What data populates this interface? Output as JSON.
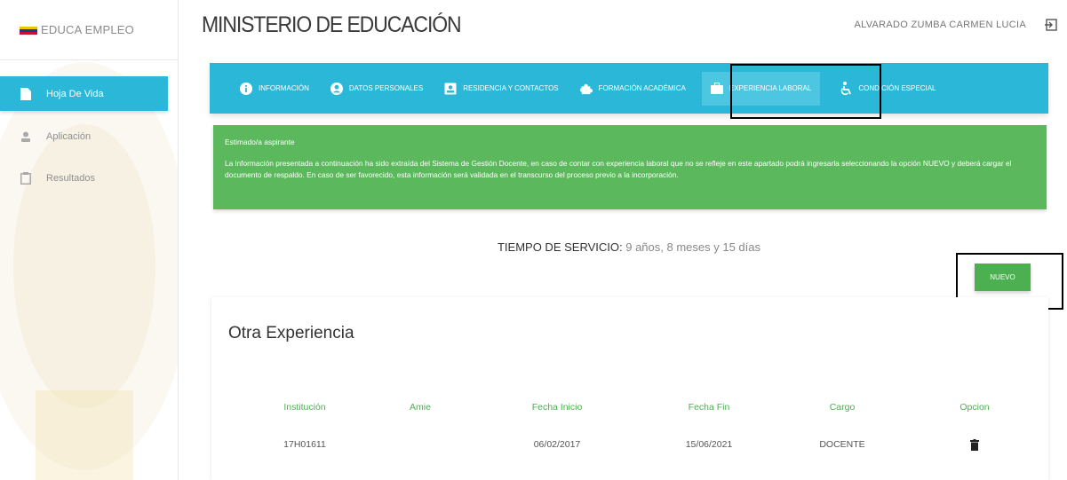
{
  "sidebar": {
    "brand": "EDUCA EMPLEO",
    "items": [
      {
        "label": "Hoja De Vida",
        "icon": "file-icon",
        "active": true
      },
      {
        "label": "Aplicación",
        "icon": "person-icon",
        "active": false
      },
      {
        "label": "Resultados",
        "icon": "clipboard-icon",
        "active": false
      }
    ]
  },
  "header": {
    "title": "MINISTERIO DE EDUCACIÓN",
    "user": "ALVARADO ZUMBA CARMEN LUCIA"
  },
  "tabs": [
    {
      "label": "INFORMACIÓN",
      "icon": "info-icon"
    },
    {
      "label": "DATOS PERSONALES",
      "icon": "account-icon"
    },
    {
      "label": "RESIDENCIA Y CONTACTOS",
      "icon": "contact-card-icon"
    },
    {
      "label": "FORMACIÓN ACADÉMICA",
      "icon": "puzzle-icon"
    },
    {
      "label": "EXPERIENCIA LABORAL",
      "icon": "briefcase-icon",
      "active": true
    },
    {
      "label": "CONDICIÓN ESPECIAL",
      "icon": "accessible-icon"
    }
  ],
  "alert": {
    "greeting": "Estimado/a aspirante",
    "message": "La información presentada a continuación ha sido extraída del Sistema de Gestión Docente, en caso de contar con experiencia laboral que no se refleje en este apartado podrá ingresarla seleccionando la opción NUEVO y deberá cargar el documento de respaldo. En caso de ser favorecido, esta información será validada en el transcurso del proceso previo a la incorporación."
  },
  "service": {
    "label": "TIEMPO DE SERVICIO:",
    "value": "9 años, 8 meses y 15 días"
  },
  "nuevo_label": "NUEVO",
  "card": {
    "title": "Otra Experiencia",
    "columns": [
      "Institución",
      "Amie",
      "Fecha Inicio",
      "Fecha Fin",
      "Cargo",
      "Opcion"
    ],
    "rows": [
      {
        "institucion": "17H01611",
        "amie": "",
        "fecha_inicio": "06/02/2017",
        "fecha_fin": "15/06/2021",
        "cargo": "DOCENTE"
      }
    ]
  },
  "colors": {
    "accent": "#2bb8d8",
    "success": "#5cb85c",
    "button_green": "#4caf50"
  }
}
